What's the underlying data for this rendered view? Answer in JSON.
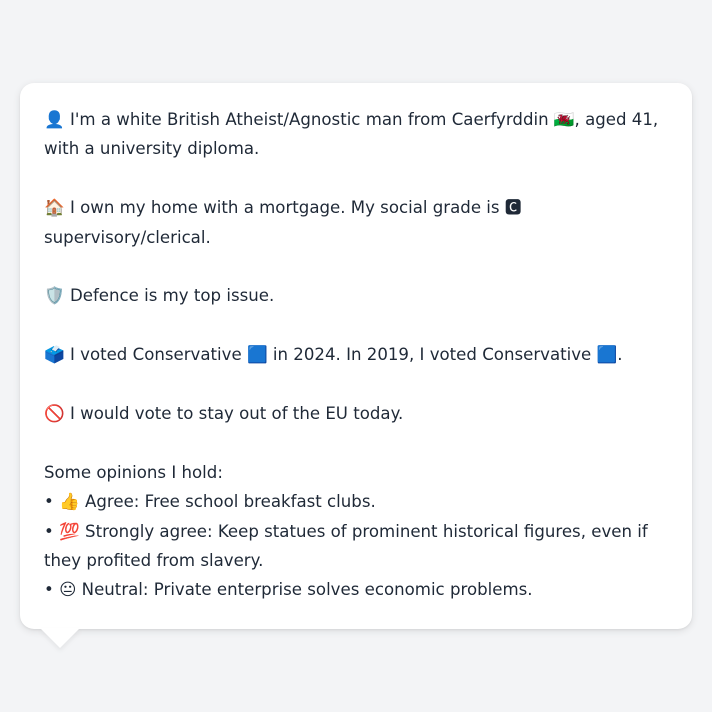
{
  "profile": {
    "intro": {
      "icon": "👤",
      "text": "I'm a white British Atheist/Agnostic man from Caerfyrddin 🏴󠁧󠁢󠁷󠁬󠁳󠁿, aged 41, with a university diploma."
    },
    "home": {
      "icon": "🏠",
      "text": "I own my home with a mortgage. My social grade is 🅲 supervisory/clerical."
    },
    "issue": {
      "icon": "🛡️",
      "text": "Defence is my top issue."
    },
    "vote": {
      "icon": "🗳️",
      "text": "I voted Conservative 🟦 in 2024. In 2019, I voted Conservative 🟦."
    },
    "eu": {
      "icon": "🚫",
      "text": "I would vote to stay out of the EU today."
    },
    "opinions_heading": "Some opinions I hold:",
    "opinions": [
      {
        "bullet": "•",
        "icon": "👍",
        "text": "Agree: Free school breakfast clubs."
      },
      {
        "bullet": "•",
        "icon": "💯",
        "text": "Strongly agree: Keep statues of prominent historical figures, even if they profited from slavery."
      },
      {
        "bullet": "•",
        "icon": "😐",
        "text": "Neutral: Private enterprise solves economic problems."
      }
    ]
  },
  "colors": {
    "background": "#f3f4f6",
    "bubble": "#ffffff",
    "text": "#1f2937"
  }
}
